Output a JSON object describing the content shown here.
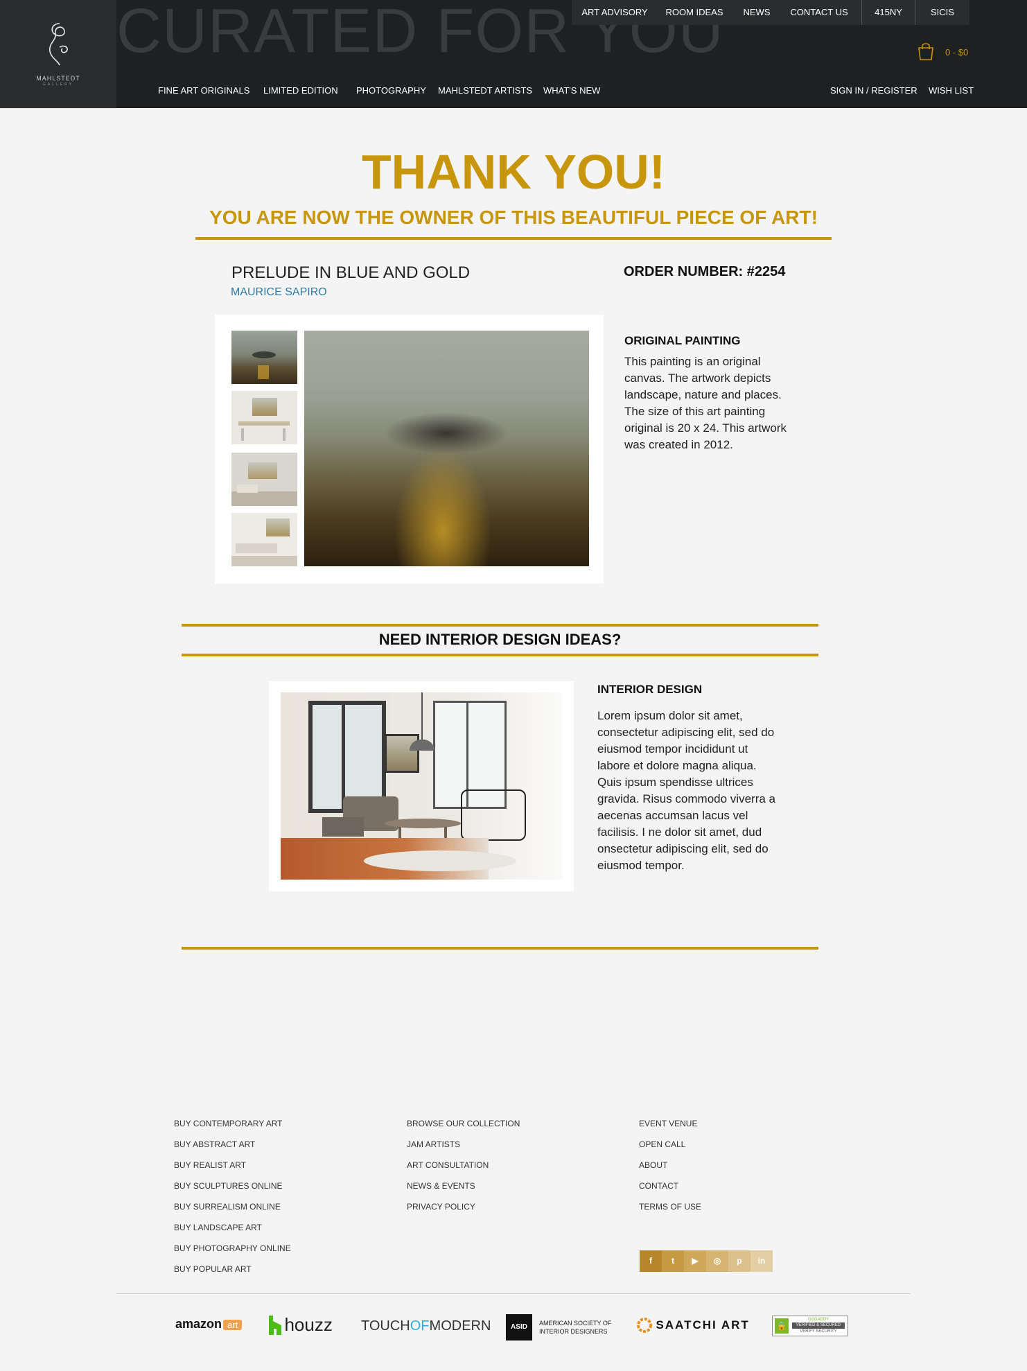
{
  "header": {
    "logo_text": "MAHLSTEDT",
    "logo_subtext": "GALLERY",
    "hero_text": "CURATED FOR YOU",
    "top_links": [
      "ART ADVISORY",
      "ROOM IDEAS",
      "NEWS",
      "CONTACT US",
      "415NY",
      "SICIS"
    ],
    "main_nav": [
      "FINE ART ORIGINALS",
      "LIMITED EDITION",
      "PHOTOGRAPHY",
      "MAHLSTEDT ARTISTS",
      "WHAT'S NEW"
    ],
    "account_links": [
      "SIGN IN / REGISTER",
      "WISH LIST"
    ],
    "cart": "0 - $0"
  },
  "confirmation": {
    "title": "THANK YOU!",
    "subtitle": "YOU ARE NOW THE OWNER OF THIS BEAUTIFUL PIECE OF ART!",
    "art_title": "PRELUDE IN BLUE AND GOLD",
    "artist": "MAURICE SAPIRO",
    "order_number": "ORDER NUMBER: #2254",
    "detail_heading": "ORIGINAL PAINTING",
    "detail_text": "This painting is an original canvas. The artwork depicts landscape, nature and places. The size of this art painting original is 20 x 24. This artwork was created in 2012."
  },
  "ideas": {
    "heading": "NEED INTERIOR DESIGN IDEAS?",
    "sub_heading": "INTERIOR DESIGN",
    "text": "Lorem ipsum dolor sit amet, consectetur adipiscing elit, sed do eiusmod tempor incididunt ut labore et dolore magna aliqua. Quis ipsum spendisse ultrices gravida. Risus commodo viverra a aecenas accumsan lacus vel facilisis. I ne dolor sit amet, dud onsectetur adipiscing elit, sed do eiusmod tempor."
  },
  "footer": {
    "col1": [
      "BUY CONTEMPORARY ART",
      "BUY ABSTRACT ART",
      "BUY REALIST ART",
      "BUY SCULPTURES ONLINE",
      "BUY SURREALISM ONLINE",
      "BUY LANDSCAPE ART",
      "BUY PHOTOGRAPHY ONLINE",
      "BUY POPULAR ART"
    ],
    "col2": [
      "BROWSE OUR COLLECTION",
      "JAM ARTISTS",
      "ART CONSULTATION",
      "NEWS & EVENTS",
      "PRIVACY POLICY"
    ],
    "col3": [
      "EVENT VENUE",
      "OPEN CALL",
      "ABOUT",
      "CONTACT",
      "TERMS OF USE"
    ],
    "social": [
      {
        "name": "facebook-icon",
        "glyph": "f",
        "color": "#b8862a"
      },
      {
        "name": "twitter-icon",
        "glyph": "t",
        "color": "#c59a42"
      },
      {
        "name": "youtube-icon",
        "glyph": "▶",
        "color": "#cfa85a"
      },
      {
        "name": "instagram-icon",
        "glyph": "◎",
        "color": "#d6b573"
      },
      {
        "name": "pinterest-icon",
        "glyph": "p",
        "color": "#dcc08b"
      },
      {
        "name": "linkedin-icon",
        "glyph": "in",
        "color": "#e3cda3"
      }
    ],
    "partners": {
      "amazon": "amazon",
      "amazon_art": "art",
      "houzz": "houzz",
      "touch_a": "TOUCH",
      "touch_b": "OF",
      "touch_c": "MODERN",
      "asid_mark": "ASID",
      "asid_line1": "AMERICAN SOCIETY OF",
      "asid_line2": "INTERIOR DESIGNERS",
      "saatchi": "SAATCHI ART",
      "godaddy_top": "GODADDY",
      "godaddy_mid": "VERIFIED & SECURED",
      "godaddy_bot": "VERIFY SECURITY"
    }
  }
}
